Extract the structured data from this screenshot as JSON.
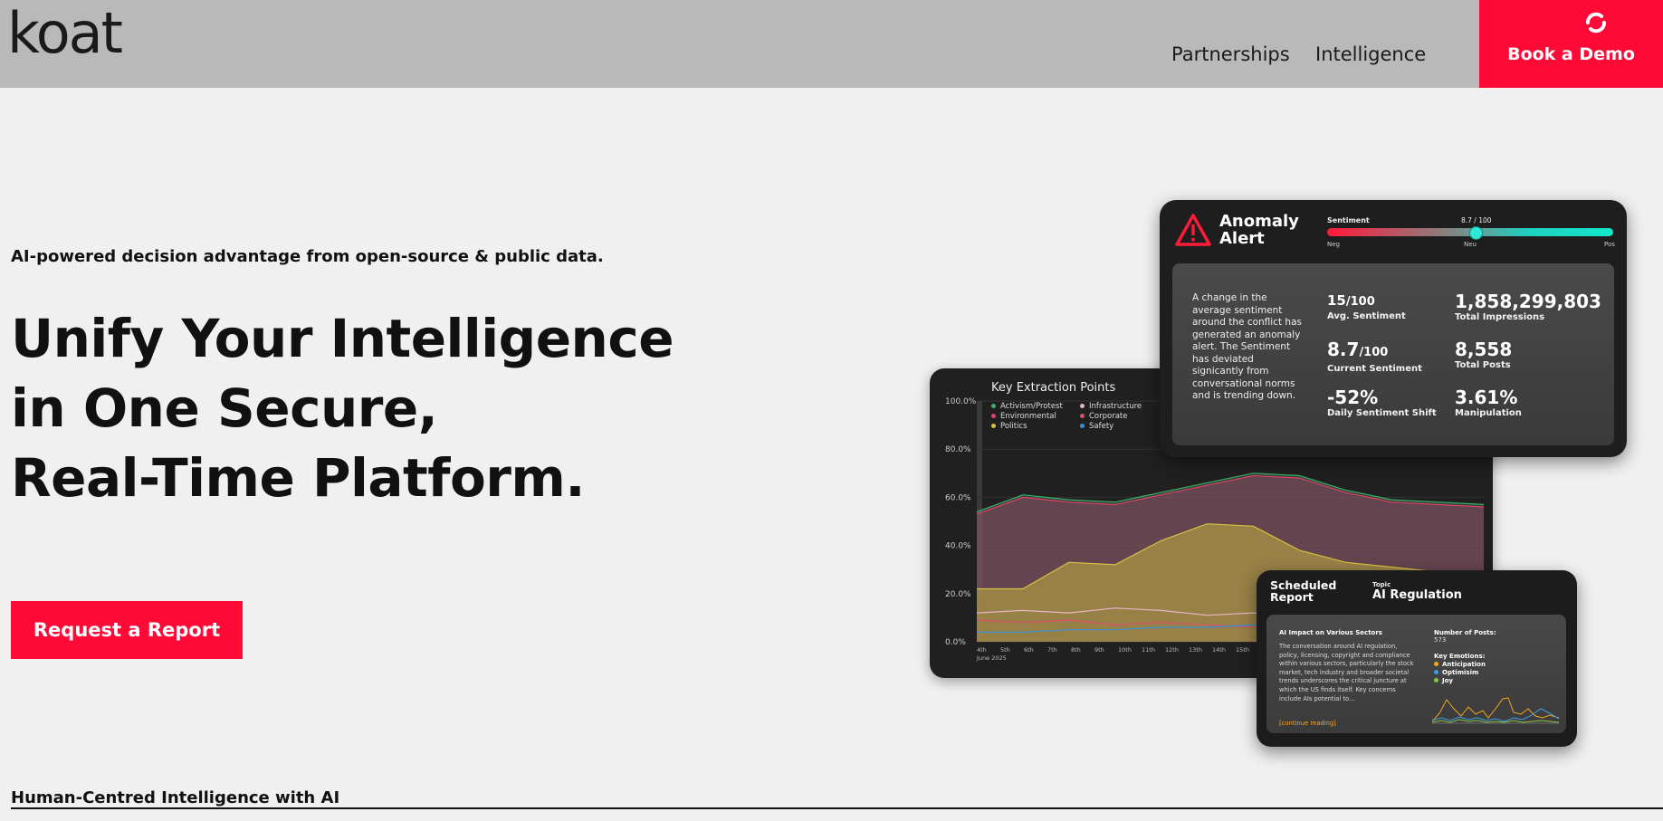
{
  "header": {
    "logo": "koat",
    "nav": [
      "Partnerships",
      "Intelligence"
    ],
    "cta": "Book a Demo"
  },
  "hero": {
    "tagline": "AI-powered decision advantage from open-source & public data.",
    "headline": [
      "Unify Your Intelligence",
      "in One Secure,",
      "Real-Time Platform."
    ],
    "button": "Request a Report"
  },
  "footer": {
    "section_title": "Human-Centred Intelligence with AI"
  },
  "anomaly": {
    "title_line1": "Anomaly",
    "title_line2": "Alert",
    "sentiment_label": "Sentiment",
    "sentiment_value": "8.7 / 100",
    "sentiment_fraction": 0.087,
    "scale": [
      "Neg",
      "Neu",
      "Pos"
    ],
    "description": "A change in the average sentiment around the conflict has generated an anomaly alert. The Sentiment has deviated signicantly from conversational norms and is trending down.",
    "stats": [
      {
        "value": "15",
        "unit": "/100",
        "label": "Avg. Sentiment"
      },
      {
        "value": "1,858,299,803",
        "unit": "",
        "label": "Total Impressions"
      },
      {
        "value": "8.7",
        "unit": "/100",
        "label": "Current Sentiment"
      },
      {
        "value": "8,558",
        "unit": "",
        "label": "Total Posts"
      },
      {
        "value": "-52%",
        "unit": "",
        "label": "Daily Sentiment Shift"
      },
      {
        "value": "3.61%",
        "unit": "",
        "label": "Manipulation"
      }
    ]
  },
  "key_extraction": {
    "title": "Key Extraction Points",
    "legend": [
      {
        "name": "Activism/Protest",
        "color": "#3fae6a"
      },
      {
        "name": "Infrastructure",
        "color": "#e8b4c8"
      },
      {
        "name": "Environmental",
        "color": "#e0406a"
      },
      {
        "name": "Corporate",
        "color": "#d9506e"
      },
      {
        "name": "Politics",
        "color": "#d8c040"
      },
      {
        "name": "Safety",
        "color": "#3a8fd8"
      }
    ],
    "y_ticks": [
      "100.0%",
      "80.0%",
      "60.0%",
      "40.0%",
      "20.0%",
      "0.0%"
    ],
    "x_ticks": [
      "4th",
      "5th",
      "6th",
      "7th",
      "8th",
      "9th",
      "10th",
      "11th",
      "12th",
      "13th",
      "14th",
      "15th"
    ],
    "x_sub": "June 2025"
  },
  "chart_data": {
    "type": "area",
    "title": "Key Extraction Points",
    "ylim": [
      0,
      100
    ],
    "x": [
      "4th",
      "5th",
      "6th",
      "7th",
      "8th",
      "9th",
      "10th",
      "11th",
      "12th",
      "13th",
      "14th",
      "15th"
    ],
    "series": [
      {
        "name": "Activism/Protest",
        "values": [
          54,
          61,
          59,
          58,
          62,
          66,
          70,
          69,
          63,
          59,
          58,
          57
        ]
      },
      {
        "name": "Environmental",
        "values": [
          53,
          60,
          58,
          57,
          61,
          65,
          69,
          68,
          62,
          58,
          57,
          56
        ]
      },
      {
        "name": "Politics",
        "values": [
          22,
          22,
          33,
          32,
          42,
          49,
          48,
          38,
          33,
          31,
          29,
          28
        ]
      },
      {
        "name": "Infrastructure",
        "values": [
          12,
          13,
          12,
          14,
          13,
          11,
          12,
          10,
          9,
          8,
          8,
          8
        ]
      },
      {
        "name": "Corporate",
        "values": [
          9,
          8,
          9,
          7,
          8,
          7,
          6,
          6,
          6,
          5,
          5,
          5
        ]
      },
      {
        "name": "Safety",
        "values": [
          4,
          4,
          5,
          5,
          6,
          6,
          7,
          6,
          5,
          5,
          5,
          5
        ]
      }
    ]
  },
  "scheduled": {
    "title_line1": "Scheduled",
    "title_line2": "Report",
    "topic_label": "Topic",
    "topic": "AI Regulation",
    "heading": "AI Impact on Various Sectors",
    "body": "The conversation around AI regulation, policy, licensing, copyright and compliance within various sectors, particularly the stock market, tech industry and broader societal trends underscores the critical juncture at which the US finds itself. Key concerns include AIs potential to...",
    "more": "[continue reading]",
    "posts_label": "Number of Posts:",
    "posts_value": "573",
    "emotions_label": "Key Emotions:",
    "emotions": [
      {
        "name": "Anticipation",
        "color": "#f5a623"
      },
      {
        "name": "Optimisim",
        "color": "#3a9fe8"
      },
      {
        "name": "Joy",
        "color": "#8bc34a"
      }
    ]
  }
}
